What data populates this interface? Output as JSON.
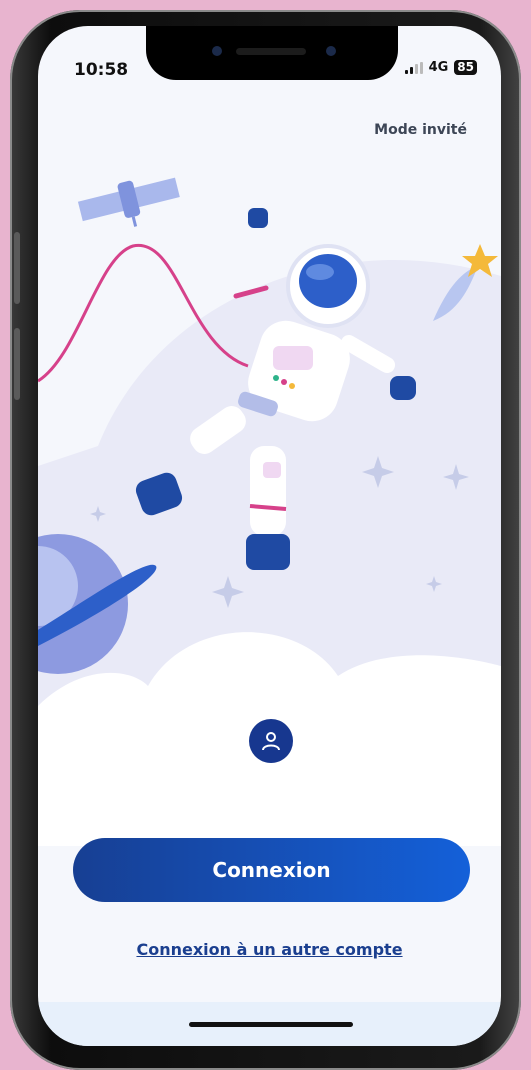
{
  "status_bar": {
    "time": "10:58",
    "network": "4G",
    "battery": "85"
  },
  "header": {
    "guest_mode_label": "Mode invité"
  },
  "actions": {
    "login_label": "Connexion",
    "other_account_label": "Connexion à un autre compte"
  },
  "colors": {
    "primary": "#173f93",
    "accent_pink": "#d6418a",
    "background": "#f5f7fc",
    "frame_bg": "#e8b4cf"
  }
}
